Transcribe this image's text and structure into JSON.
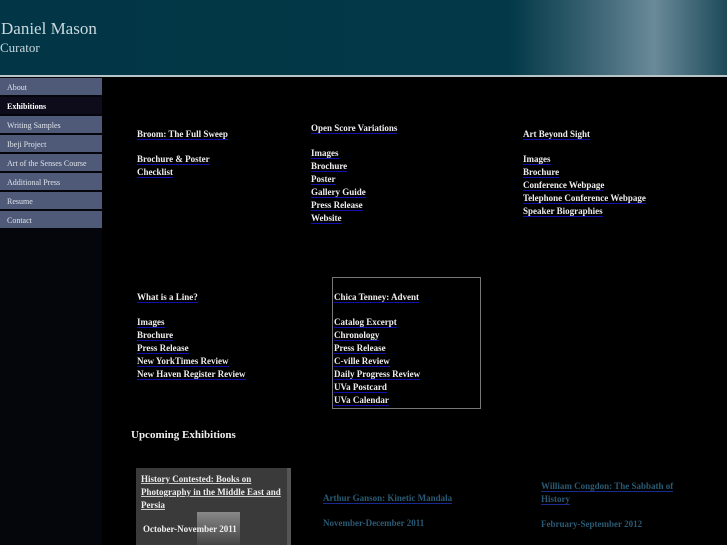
{
  "header": {
    "name": "Daniel Mason",
    "subtitle": "Curator"
  },
  "nav": [
    {
      "label": "About"
    },
    {
      "label": "Exhibitions",
      "active": true
    },
    {
      "label": "Writing Samples"
    },
    {
      "label": "Ibeji Project"
    },
    {
      "label": "Art of the Senses Course"
    },
    {
      "label": "Additional Press"
    },
    {
      "label": "Resume"
    },
    {
      "label": "Contact"
    }
  ],
  "exhibitions": [
    {
      "title": "Broom: The Full Sweep",
      "links": [
        "Brochure & Poster",
        "Checklist"
      ]
    },
    {
      "title": "Open Score  Variations",
      "links": [
        "Images",
        "Brochure",
        "Poster",
        "Gallery Guide",
        "Press Release",
        "Website"
      ]
    },
    {
      "title": "Art Beyond Sight",
      "links": [
        "Images",
        "Brochure",
        "Conference Webpage",
        "Telephone Conference Webpage",
        "Speaker Biographies"
      ]
    },
    {
      "title": "What is a Line?",
      "links": [
        "Images",
        "Brochure",
        "Press Release",
        "New YorkTimes Review",
        "New Haven Register Review"
      ]
    },
    {
      "title": "Chica Tenney: Advent",
      "links": [
        "Catalog Excerpt",
        "Chronology",
        "Press Release",
        "C-ville Review",
        "Daily Progress Review",
        "UVa Postcard",
        "UVa Calendar"
      ]
    }
  ],
  "upcoming": {
    "heading": "Upcoming Exhibitions",
    "items": [
      {
        "title": "History Contested: Books on Photography in the Middle East and Persia",
        "dates": "October-November 2011"
      },
      {
        "title": "Arthur Ganson: Kinetic Mandala",
        "dates": "November-December 2011"
      },
      {
        "title": "William Congdon: The Sabbath of History",
        "dates": "February-September 2012"
      }
    ]
  },
  "colors": {
    "header": "#023847",
    "nav": "#4e5a78",
    "link_underline": "#1010b0",
    "upcoming_text": "#2a5a74"
  }
}
